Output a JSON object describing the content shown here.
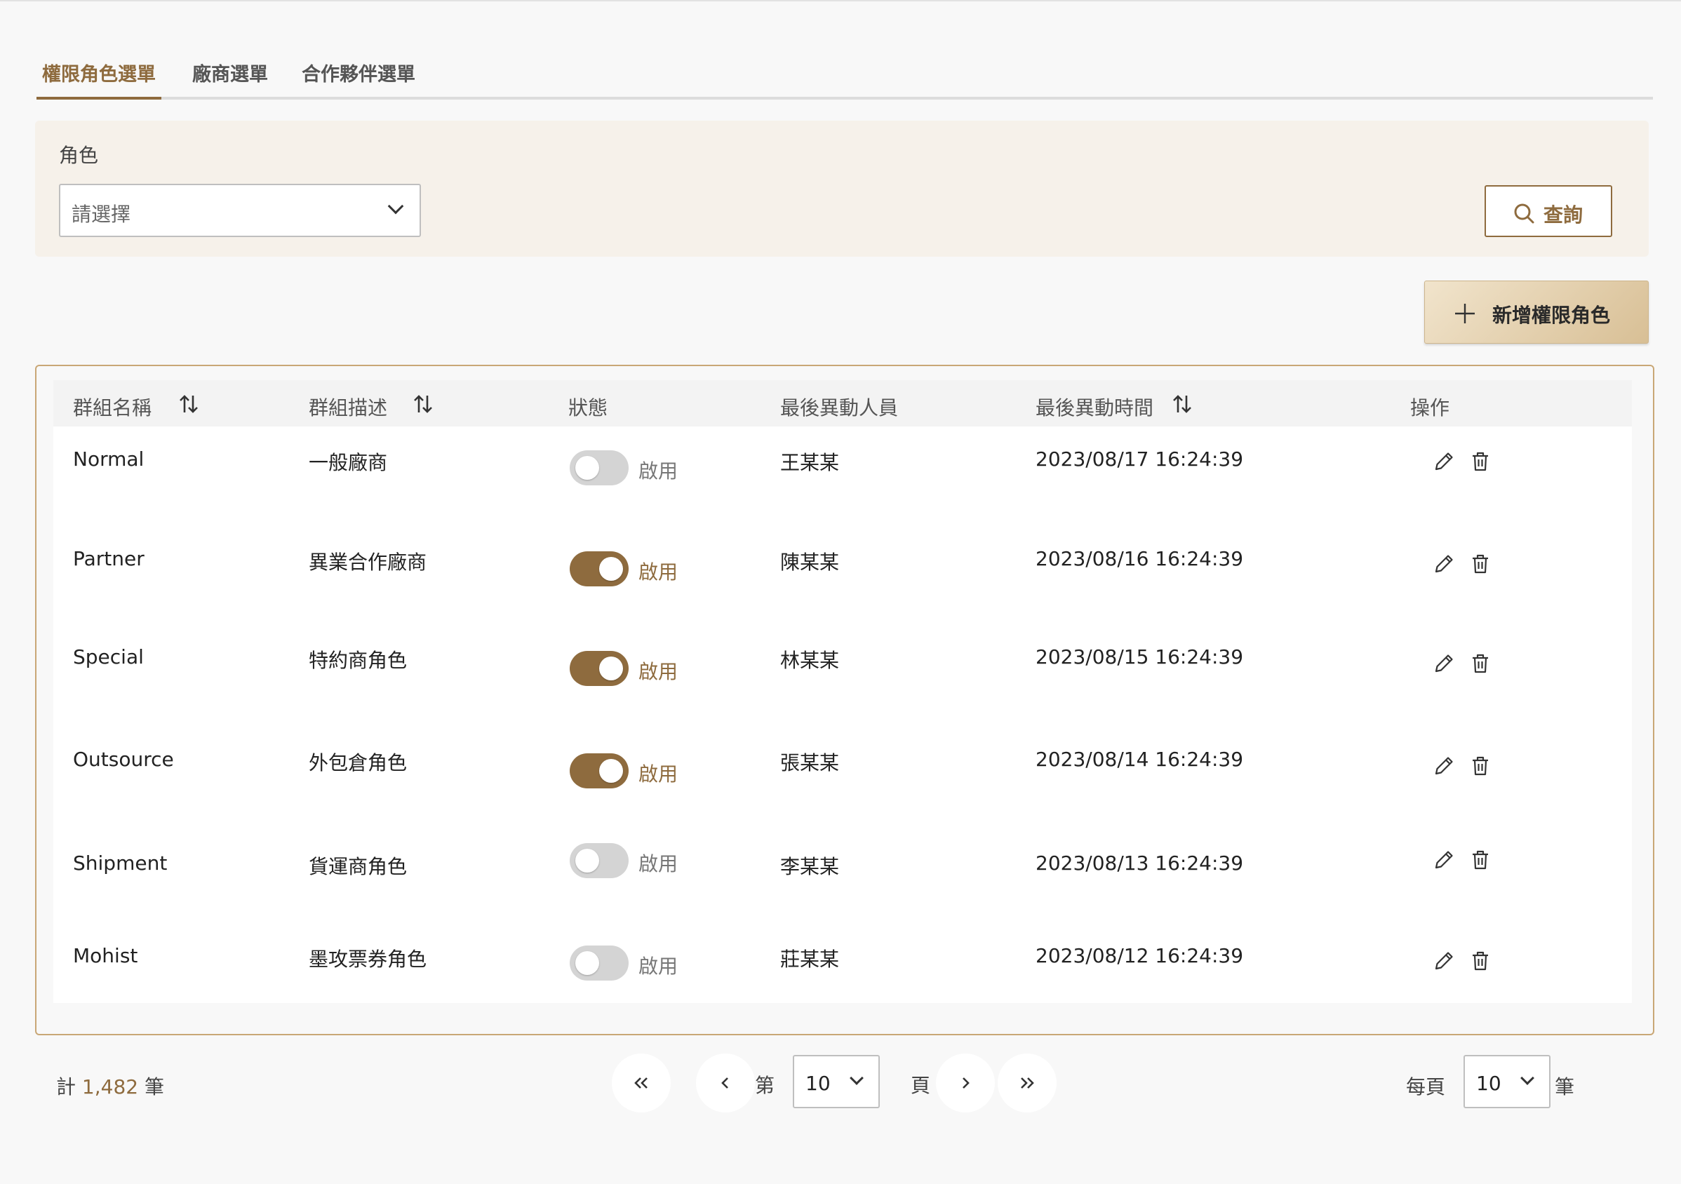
{
  "tabs": [
    {
      "label": "權限角色選單",
      "active": true
    },
    {
      "label": "廠商選單",
      "active": false
    },
    {
      "label": "合作夥伴選單",
      "active": false
    }
  ],
  "filter": {
    "role_label": "角色",
    "role_placeholder": "請選擇",
    "query_label": "查詢"
  },
  "add_button": {
    "label": "新增權限角色"
  },
  "table": {
    "headers": {
      "name": "群組名稱",
      "description": "群組描述",
      "status": "狀態",
      "modifier": "最後異動人員",
      "modified_time": "最後異動時間",
      "actions": "操作"
    },
    "rows": [
      {
        "name": "Normal",
        "description": "一般廠商",
        "enabled": false,
        "status_label": "啟用",
        "modifier": "王某某",
        "time": "2023/08/17 16:24:39"
      },
      {
        "name": "Partner",
        "description": "異業合作廠商",
        "enabled": true,
        "status_label": "啟用",
        "modifier": "陳某某",
        "time": "2023/08/16 16:24:39"
      },
      {
        "name": "Special",
        "description": "特約商角色",
        "enabled": true,
        "status_label": "啟用",
        "modifier": "林某某",
        "time": "2023/08/15 16:24:39"
      },
      {
        "name": "Outsource",
        "description": "外包倉角色",
        "enabled": true,
        "status_label": "啟用",
        "modifier": "張某某",
        "time": "2023/08/14 16:24:39"
      },
      {
        "name": "Shipment",
        "description": "貨運商角色",
        "enabled": false,
        "status_label": "啟用",
        "modifier": "李某某",
        "time": "2023/08/13 16:24:39"
      },
      {
        "name": "Mohist",
        "description": "墨攻票券角色",
        "enabled": false,
        "status_label": "啟用",
        "modifier": "莊某某",
        "time": "2023/08/12 16:24:39"
      }
    ]
  },
  "footer": {
    "total_prefix": "計",
    "total_count": "1,482",
    "total_suffix": "筆",
    "page_prefix": "第",
    "current_page": "10",
    "page_suffix": "頁",
    "per_page_prefix": "每頁",
    "per_page": "10",
    "per_page_suffix": "筆"
  },
  "colors": {
    "accent": "#8e6b3e",
    "toggle_off": "#d4d4d4",
    "filter_bg": "#f6f1ea",
    "panel_border": "#c9a776"
  },
  "icons": [
    "search-icon",
    "plus-icon",
    "sort-icon",
    "edit-icon",
    "trash-icon",
    "chevron-down-icon",
    "first-page-icon",
    "prev-page-icon",
    "next-page-icon",
    "last-page-icon"
  ]
}
